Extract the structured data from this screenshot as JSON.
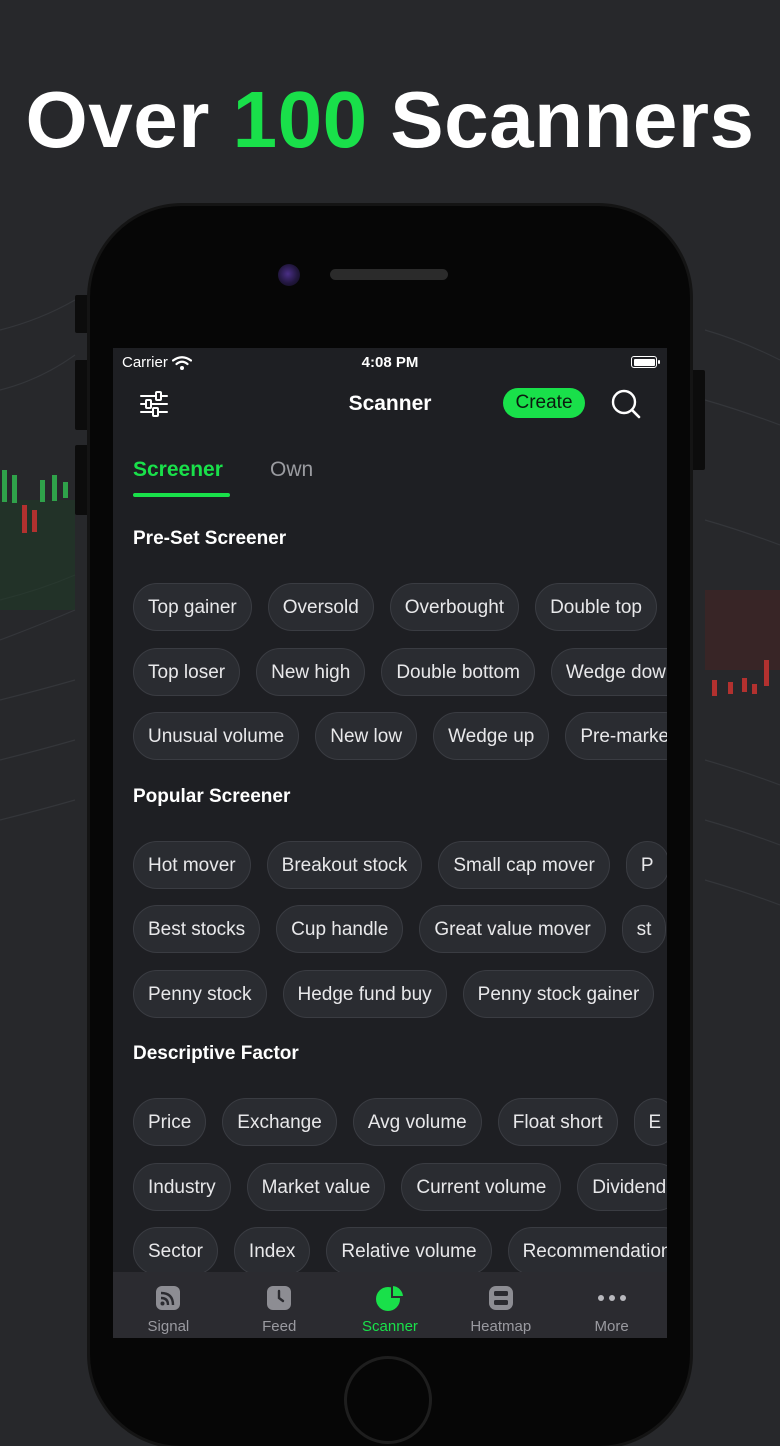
{
  "headline": {
    "prefix": "Over",
    "accent": "100",
    "suffix": "Scanners"
  },
  "colors": {
    "accent": "#19e04a",
    "background": "#27282b",
    "screen": "#1e1f23",
    "chip": "#2a2c31",
    "tabbar": "#2b2b30"
  },
  "status": {
    "carrier": "Carrier",
    "time": "4:08 PM"
  },
  "nav": {
    "title": "Scanner",
    "create_label": "Create",
    "filter_icon": "sliders-icon",
    "search_icon": "search-icon"
  },
  "tabs": [
    {
      "label": "Screener",
      "active": true
    },
    {
      "label": "Own",
      "active": false
    }
  ],
  "sections": [
    {
      "title": "Pre-Set Screener",
      "rows": [
        [
          "Top gainer",
          "Oversold",
          "Overbought",
          "Double top"
        ],
        [
          "Top loser",
          "New high",
          "Double bottom",
          "Wedge down"
        ],
        [
          "Unusual volume",
          "New low",
          "Wedge up",
          "Pre-market"
        ]
      ]
    },
    {
      "title": "Popular Screener",
      "rows": [
        [
          "Hot mover",
          "Breakout stock",
          "Small cap mover",
          "P"
        ],
        [
          "Best stocks",
          "Cup handle",
          "Great value mover",
          "st"
        ],
        [
          "Penny stock",
          "Hedge fund buy",
          "Penny stock gainer"
        ]
      ]
    },
    {
      "title": "Descriptive Factor",
      "rows": [
        [
          "Price",
          "Exchange",
          "Avg volume",
          "Float short",
          "E"
        ],
        [
          "Industry",
          "Market value",
          "Current volume",
          "Dividend"
        ],
        [
          "Sector",
          "Index",
          "Relative volume",
          "Recommendation"
        ]
      ]
    }
  ],
  "tabbar": [
    {
      "label": "Signal",
      "icon": "signal-icon",
      "active": false
    },
    {
      "label": "Feed",
      "icon": "clock-icon",
      "active": false
    },
    {
      "label": "Scanner",
      "icon": "pie-chart-icon",
      "active": true
    },
    {
      "label": "Heatmap",
      "icon": "heatmap-icon",
      "active": false
    },
    {
      "label": "More",
      "icon": "more-dots-icon",
      "active": false
    }
  ]
}
